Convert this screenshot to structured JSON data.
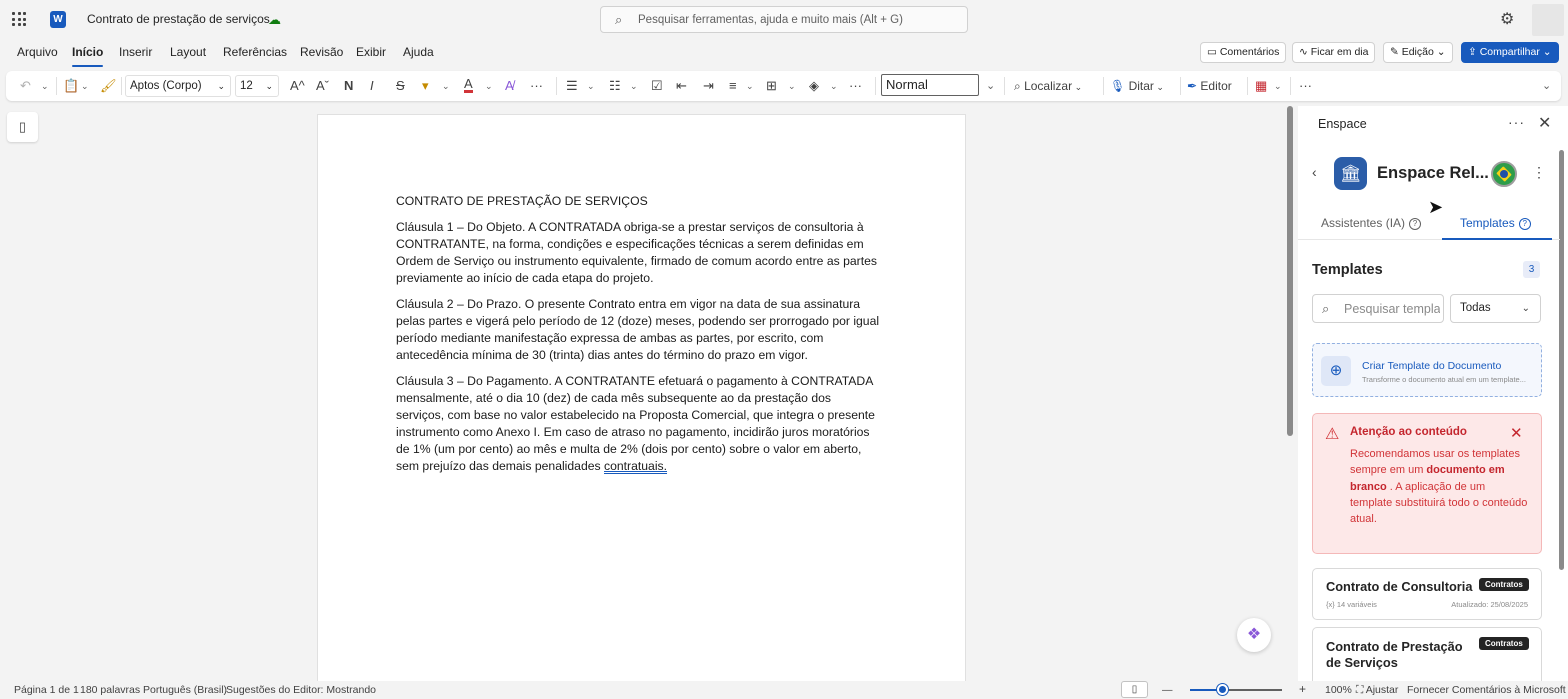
{
  "titlebar": {
    "app_icon": "W",
    "doc_title": "Contrato de prestação de serviços",
    "save_status_icon": "cloud-check-icon",
    "search_placeholder": "Pesquisar ferramentas, ajuda e muito mais (Alt + G)"
  },
  "menu": {
    "items": [
      "Arquivo",
      "Início",
      "Inserir",
      "Layout",
      "Referências",
      "Revisão",
      "Exibir",
      "Ajuda"
    ],
    "active": "Início",
    "comments": "Comentários",
    "catch_up": "Ficar em dia",
    "editing": "Edição",
    "share": "Compartilhar"
  },
  "ribbon": {
    "font": "Aptos (Corpo)",
    "font_size": "12",
    "bold": "N",
    "italic": "I",
    "strike": "S",
    "style": "Normal",
    "find": "Localizar",
    "dictate": "Ditar",
    "editor": "Editor"
  },
  "document": {
    "heading": "CONTRATO DE PRESTAÇÃO DE SERVIÇOS",
    "clause1": "Cláusula 1 – Do Objeto. A CONTRATADA obriga-se a prestar serviços de consultoria à CONTRATANTE, na forma, condições e especificações técnicas a serem definidas em Ordem de Serviço ou instrumento equivalente, firmado de comum acordo entre as partes previamente ao início de cada etapa do projeto.",
    "clause2": "Cláusula 2 – Do Prazo. O presente Contrato entra em vigor na data de sua assinatura pelas partes e vigerá pelo período de 12 (doze) meses, podendo ser prorrogado por igual período mediante manifestação expressa de ambas as partes, por escrito, com antecedência mínima de 30 (trinta) dias antes do término do prazo em vigor.",
    "clause3_main": "Cláusula 3 – Do Pagamento. A CONTRATANTE efetuará o pagamento à CONTRATADA mensalmente, até o dia 10 (dez) de cada mês subsequente ao da prestação dos serviços, com base no valor estabelecido na Proposta Comercial, que integra o presente instrumento como Anexo I. Em caso de atraso no pagamento, incidirão juros moratórios de 1% (um por cento) ao mês e multa de 2% (dois por cento) sobre o valor em aberto, sem prejuízo das demais penalidades ",
    "clause3_last": "contratuais."
  },
  "pane": {
    "title": "Enspace",
    "app_name": "Enspace Rel...",
    "tab_assistants": "Assistentes (IA)",
    "tab_templates": "Templates",
    "section_title": "Templates",
    "count": "3",
    "search_placeholder": "Pesquisar templates",
    "filter": "Todas",
    "create_title": "Criar Template do Documento",
    "create_subtitle": "Transforme o documento atual em um template...",
    "warning_title": "Atenção ao conteúdo",
    "warning_pre": "Recomendamos usar os templates sempre em um ",
    "warning_bold": "documento em branco",
    "warning_post": " . A aplicação de um template substituirá todo o conteúdo atual.",
    "cards": [
      {
        "title": "Contrato de Consultoria",
        "badge": "Contratos",
        "meta": "{x}  14 variáveis",
        "date": "Atualizado: 25/08/2025"
      },
      {
        "title": "Contrato de Prestação de Serviços",
        "badge": "Contratos"
      }
    ]
  },
  "status": {
    "page": "Página 1 de 1",
    "words": "180 palavras",
    "language": "Português (Brasil)",
    "editor": "Sugestões do Editor: Mostrando",
    "zoom": "100%",
    "zoom_level": 0.35,
    "fit": "Ajustar",
    "feedback": "Fornecer Comentários à Microsoft"
  }
}
